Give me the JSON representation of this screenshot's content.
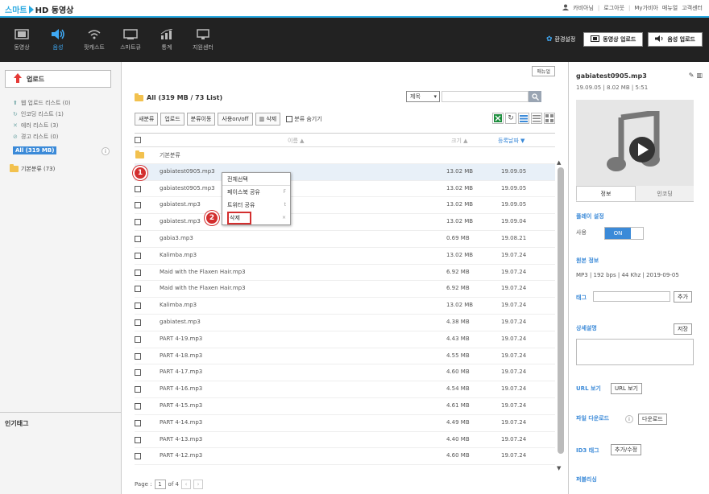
{
  "brand": {
    "part1": "스마트",
    "part2": "HD 동영상"
  },
  "top_links": [
    "카비아님",
    "로그아웃",
    "My가비아",
    "매뉴얼",
    "고객센터"
  ],
  "nav": [
    {
      "label": "동영상",
      "icon": "film-icon"
    },
    {
      "label": "음성",
      "icon": "speaker-icon"
    },
    {
      "label": "팟캐스트",
      "icon": "podcast-icon"
    },
    {
      "label": "스마트큐",
      "icon": "monitor-icon"
    },
    {
      "label": "통계",
      "icon": "chart-icon"
    },
    {
      "label": "지원센터",
      "icon": "support-icon"
    }
  ],
  "nav_active": "음성",
  "nav_right": {
    "env": "환경설정",
    "video_upload": "동영상 업로드",
    "audio_upload": "음성 업로드"
  },
  "left": {
    "upload": "업로드",
    "lists": [
      "웹 업로드 리스트 (0)",
      "인코딩 리스트 (1)",
      "에러 리스트 (3)",
      "경고 리스트 (0)"
    ],
    "all": "All (319 MB)",
    "info": "i",
    "basic_folder": "기본분류 (73)",
    "tags_title": "인기태그"
  },
  "main": {
    "manual": "매뉴얼",
    "title": "All (319 MB / 73 List)",
    "search_select": "제목",
    "toolbar": [
      "새분류",
      "업로드",
      "분류이동",
      "사용on/off",
      "삭제"
    ],
    "hide_label": "분류 숨기기",
    "columns": {
      "name": "이름 ▲",
      "size": "크기 ▲",
      "date": "등록날짜 ▼"
    },
    "folder_row": "기본분류",
    "rows": [
      {
        "name": "gabiatest0905.mp3",
        "size": "13.02 MB",
        "date": "19.09.05"
      },
      {
        "name": "gabiatest0905.mp3",
        "size": "13.02 MB",
        "date": "19.09.05"
      },
      {
        "name": "gabiatest.mp3",
        "size": "13.02 MB",
        "date": "19.09.05"
      },
      {
        "name": "gabiatest.mp3",
        "size": "13.02 MB",
        "date": "19.09.04"
      },
      {
        "name": "gabia3.mp3",
        "size": "0.69 MB",
        "date": "19.08.21"
      },
      {
        "name": "Kalimba.mp3",
        "size": "13.02 MB",
        "date": "19.07.24"
      },
      {
        "name": "Maid with the Flaxen Hair.mp3",
        "size": "6.92 MB",
        "date": "19.07.24"
      },
      {
        "name": "Maid with the Flaxen Hair.mp3",
        "size": "6.92 MB",
        "date": "19.07.24"
      },
      {
        "name": "Kalimba.mp3",
        "size": "13.02 MB",
        "date": "19.07.24"
      },
      {
        "name": "gabiatest.mp3",
        "size": "4.38 MB",
        "date": "19.07.24"
      },
      {
        "name": "PART 4-19.mp3",
        "size": "4.43 MB",
        "date": "19.07.24"
      },
      {
        "name": "PART 4-18.mp3",
        "size": "4.55 MB",
        "date": "19.07.24"
      },
      {
        "name": "PART 4-17.mp3",
        "size": "4.60 MB",
        "date": "19.07.24"
      },
      {
        "name": "PART 4-16.mp3",
        "size": "4.54 MB",
        "date": "19.07.24"
      },
      {
        "name": "PART 4-15.mp3",
        "size": "4.61 MB",
        "date": "19.07.24"
      },
      {
        "name": "PART 4-14.mp3",
        "size": "4.49 MB",
        "date": "19.07.24"
      },
      {
        "name": "PART 4-13.mp3",
        "size": "4.40 MB",
        "date": "19.07.24"
      },
      {
        "name": "PART 4-12.mp3",
        "size": "4.60 MB",
        "date": "19.07.24"
      }
    ],
    "pager": {
      "label": "Page :",
      "current": "1",
      "of": "of 4"
    }
  },
  "context_menu": [
    {
      "label": "전체선택",
      "key": ""
    },
    {
      "label": "페이스북 공유",
      "key": "F"
    },
    {
      "label": "트위터 공유",
      "key": "t"
    },
    {
      "label": "삭제",
      "key": "×"
    }
  ],
  "badges": [
    "1",
    "2"
  ],
  "right": {
    "filename": "gabiatest0905.mp3",
    "meta": "19.09.05 | 8.02 MB | 5:51",
    "tabs": [
      "정보",
      "인코딩"
    ],
    "play_setting": "플레이 설정",
    "use_label": "사용",
    "toggle": "ON",
    "source_info_title": "원본 정보",
    "source_info": "MP3 | 192 bps | 44 Khz | 2019-09-05",
    "tag_label": "태그",
    "add": "추가",
    "desc_title": "상세설명",
    "save": "저장",
    "url_label": "URL 보기",
    "url_btn": "URL 보기",
    "download_label": "파일 다운로드",
    "download_btn": "다운로드",
    "id3_label": "ID3 태그",
    "id3_btn": "추가/수정",
    "publish_label": "퍼블리싱"
  },
  "colors": {
    "accent": "#27a9e1",
    "active_blue": "#3b8ad8",
    "marker_red": "#d32f2f"
  }
}
